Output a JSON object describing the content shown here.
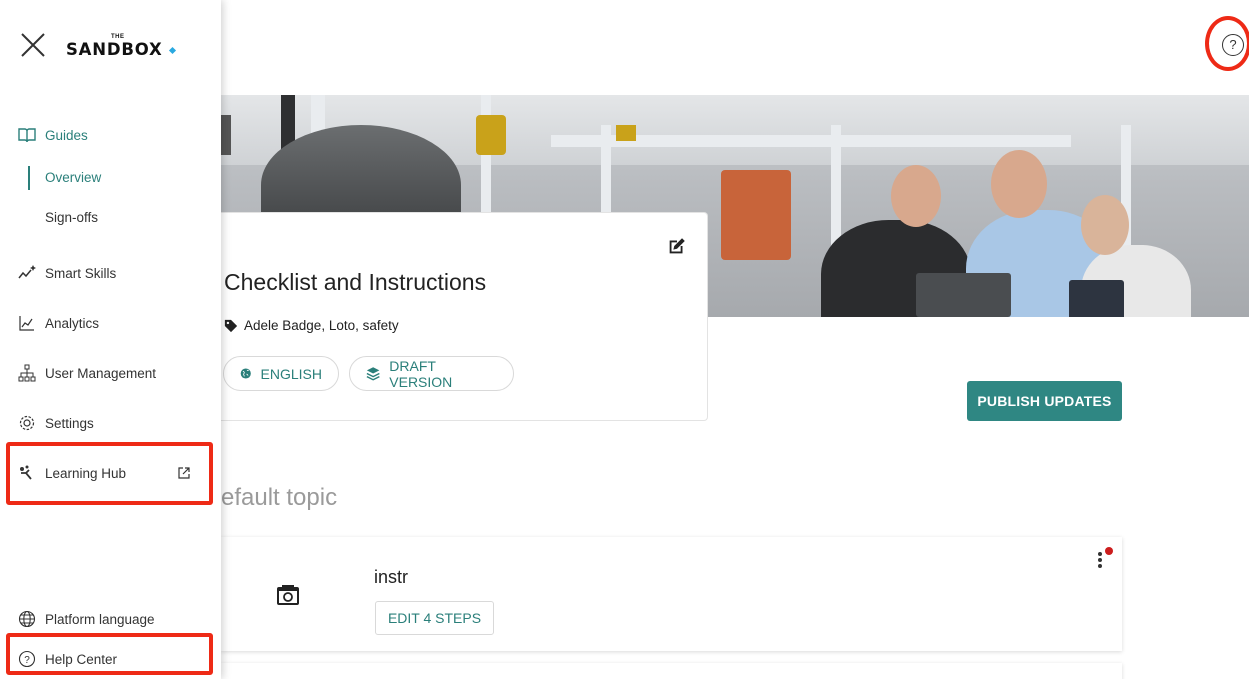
{
  "brand": {
    "logo_small": "THE",
    "logo_text": "SANDBOX"
  },
  "sidebar": {
    "guides": "Guides",
    "overview": "Overview",
    "signoffs": "Sign-offs",
    "smart_skills": "Smart Skills",
    "analytics": "Analytics",
    "user_management": "User Management",
    "settings": "Settings",
    "learning_hub": "Learning Hub",
    "platform_language": "Platform language",
    "help_center": "Help Center"
  },
  "guide": {
    "title": "Checklist and Instructions",
    "tags": "Adele Badge, Loto, safety",
    "language_label": "ENGLISH",
    "version_label": "DRAFT VERSION",
    "publish_label": "PUBLISH UPDATES"
  },
  "topic": {
    "title": "efault topic",
    "steps": [
      {
        "name": "instr",
        "edit_label": "EDIT 4 STEPS"
      }
    ]
  },
  "colors": {
    "accent": "#2f8783",
    "annotation": "#ee2a16",
    "notification": "#cc1d1d"
  }
}
